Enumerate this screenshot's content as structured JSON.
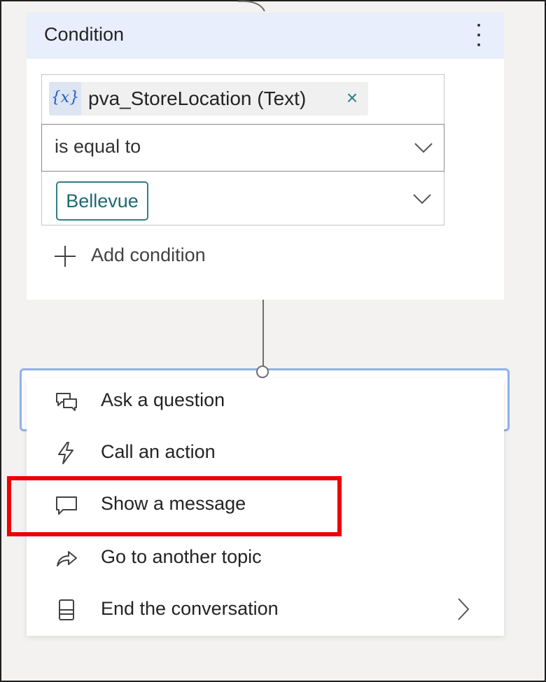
{
  "condition_card": {
    "title": "Condition",
    "variable": {
      "icon_text": "{x}",
      "name": "pva_StoreLocation (Text)"
    },
    "operator": "is equal to",
    "value": "Bellevue",
    "add_condition_label": "Add condition"
  },
  "menu": {
    "items": [
      {
        "label": "Ask a question",
        "icon": "question-bubble-icon"
      },
      {
        "label": "Call an action",
        "icon": "lightning-icon"
      },
      {
        "label": "Show a message",
        "icon": "message-bubble-icon"
      },
      {
        "label": "Go to another topic",
        "icon": "redirect-arrow-icon"
      },
      {
        "label": "End the conversation",
        "icon": "end-icon",
        "has_submenu": true
      }
    ]
  },
  "colors": {
    "header_bg": "#e8eefb",
    "accent_teal": "#2f7f86",
    "selection_outline": "#8fb1e8",
    "highlight": "#ee0000"
  }
}
